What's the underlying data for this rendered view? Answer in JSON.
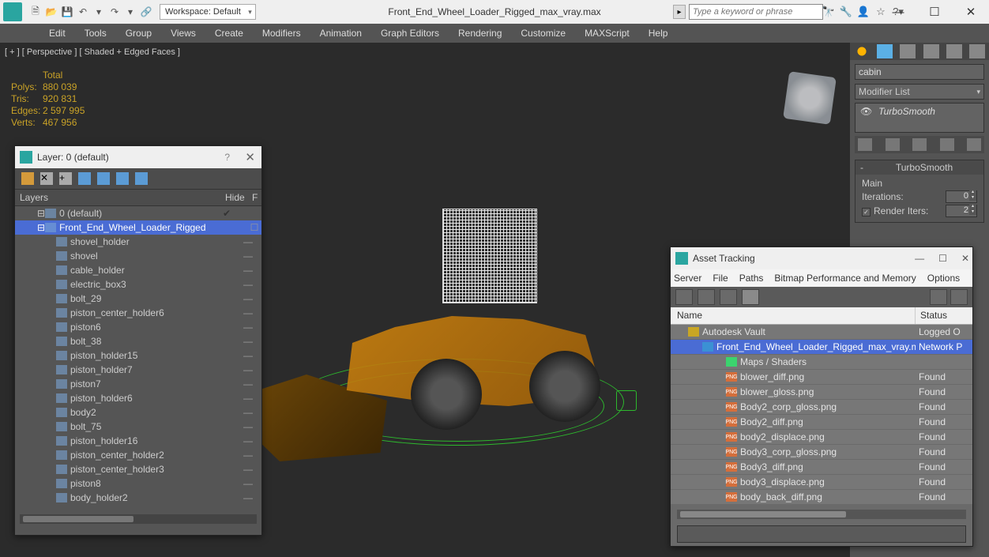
{
  "title": "Front_End_Wheel_Loader_Rigged_max_vray.max",
  "workspace": "Workspace: Default",
  "search_placeholder": "Type a keyword or phrase",
  "menus": [
    "Edit",
    "Tools",
    "Group",
    "Views",
    "Create",
    "Modifiers",
    "Animation",
    "Graph Editors",
    "Rendering",
    "Customize",
    "MAXScript",
    "Help"
  ],
  "viewport_label": "[ + ] [ Perspective ] [ Shaded + Edged Faces ]",
  "stats": {
    "header": "Total",
    "polys_l": "Polys:",
    "polys_v": "880 039",
    "tris_l": "Tris:",
    "tris_v": "920 831",
    "edges_l": "Edges:",
    "edges_v": "2 597 995",
    "verts_l": "Verts:",
    "verts_v": "467 956"
  },
  "right_panel": {
    "object_name": "cabin",
    "modifier_list": "Modifier List",
    "modifier_stack": "TurboSmooth",
    "section_title": "TurboSmooth",
    "main_label": "Main",
    "iterations_label": "Iterations:",
    "iterations_val": "0",
    "render_iters_label": "Render Iters:",
    "render_iters_val": "2"
  },
  "layer_dialog": {
    "title": "Layer: 0 (default)",
    "col_layers": "Layers",
    "col_hide": "Hide",
    "col_f": "F",
    "root": "0 (default)",
    "selected": "Front_End_Wheel_Loader_Rigged",
    "items": [
      "shovel_holder",
      "shovel",
      "cable_holder",
      "electric_box3",
      "bolt_29",
      "piston_center_holder6",
      "piston6",
      "bolt_38",
      "piston_holder15",
      "piston_holder7",
      "piston7",
      "piston_holder6",
      "body2",
      "bolt_75",
      "piston_holder16",
      "piston_center_holder2",
      "piston_center_holder3",
      "piston8",
      "body_holder2"
    ]
  },
  "asset_dialog": {
    "title": "Asset Tracking",
    "menus": [
      "Server",
      "File",
      "Paths",
      "Bitmap Performance and Memory",
      "Options"
    ],
    "col_name": "Name",
    "col_status": "Status",
    "rows": [
      {
        "indent": 1,
        "icon": "vault",
        "name": "Autodesk Vault",
        "status": "Logged O",
        "sel": false
      },
      {
        "indent": 2,
        "icon": "file",
        "name": "Front_End_Wheel_Loader_Rigged_max_vray.max",
        "status": "Network P",
        "sel": true
      },
      {
        "indent": 3,
        "icon": "shader",
        "name": "Maps / Shaders",
        "status": "",
        "sel": false
      },
      {
        "indent": 3,
        "icon": "png",
        "name": "blower_diff.png",
        "status": "Found",
        "sel": false
      },
      {
        "indent": 3,
        "icon": "png",
        "name": "blower_gloss.png",
        "status": "Found",
        "sel": false
      },
      {
        "indent": 3,
        "icon": "png",
        "name": "Body2_corp_gloss.png",
        "status": "Found",
        "sel": false
      },
      {
        "indent": 3,
        "icon": "png",
        "name": "Body2_diff.png",
        "status": "Found",
        "sel": false
      },
      {
        "indent": 3,
        "icon": "png",
        "name": "body2_displace.png",
        "status": "Found",
        "sel": false
      },
      {
        "indent": 3,
        "icon": "png",
        "name": "Body3_corp_gloss.png",
        "status": "Found",
        "sel": false
      },
      {
        "indent": 3,
        "icon": "png",
        "name": "Body3_diff.png",
        "status": "Found",
        "sel": false
      },
      {
        "indent": 3,
        "icon": "png",
        "name": "body3_displace.png",
        "status": "Found",
        "sel": false
      },
      {
        "indent": 3,
        "icon": "png",
        "name": "body_back_diff.png",
        "status": "Found",
        "sel": false
      }
    ]
  }
}
